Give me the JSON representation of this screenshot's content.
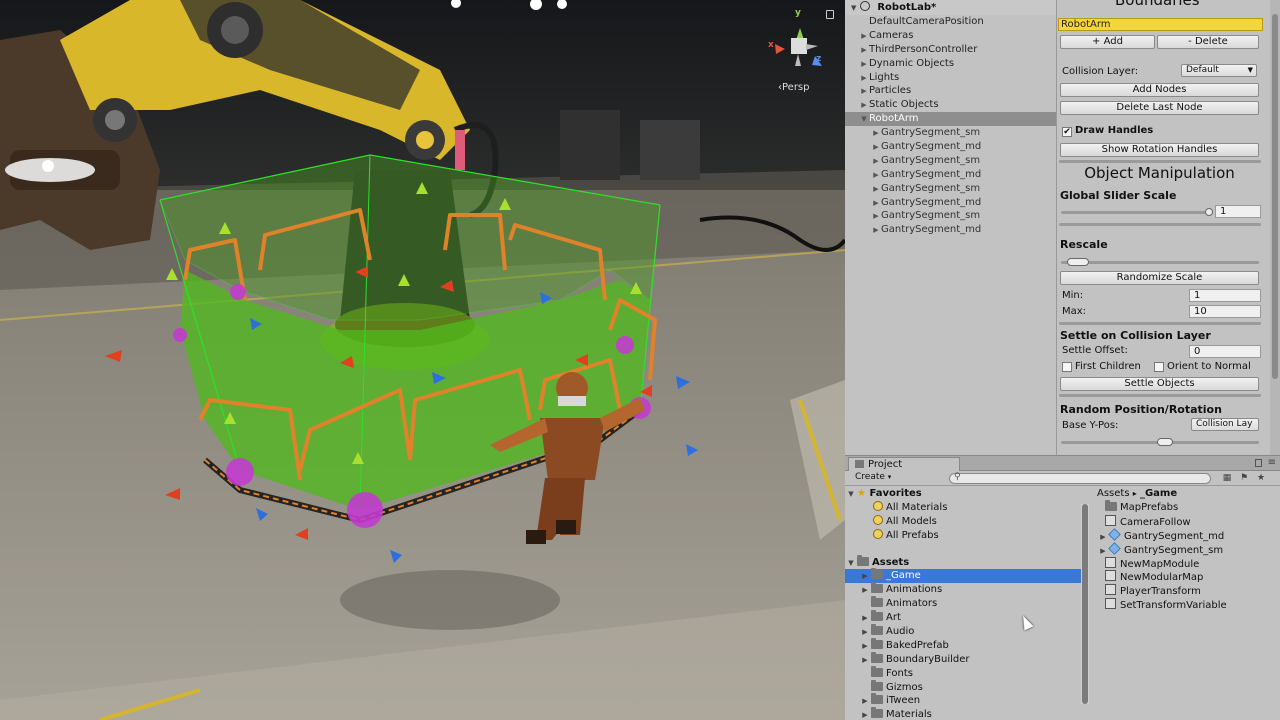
{
  "scene": {
    "persp_label": "‹Persp",
    "axis_y": "y",
    "axis_x": "x",
    "axis_z": "z"
  },
  "hierarchy": {
    "scene_name": "RobotLab*",
    "items": [
      {
        "label": "DefaultCameraPosition",
        "arrow": ""
      },
      {
        "label": "Cameras",
        "arrow": "▶"
      },
      {
        "label": "ThirdPersonController",
        "arrow": "▶"
      },
      {
        "label": "Dynamic Objects",
        "arrow": "▶"
      },
      {
        "label": "Lights",
        "arrow": "▶"
      },
      {
        "label": "Particles",
        "arrow": "▶"
      },
      {
        "label": "Static Objects",
        "arrow": "▶"
      },
      {
        "label": "RobotArm",
        "arrow": "▼",
        "selected": true
      },
      {
        "label": "GantrySegment_sm",
        "arrow": "▶",
        "child": true
      },
      {
        "label": "GantrySegment_md",
        "arrow": "▶",
        "child": true
      },
      {
        "label": "GantrySegment_sm",
        "arrow": "▶",
        "child": true
      },
      {
        "label": "GantrySegment_md",
        "arrow": "▶",
        "child": true
      },
      {
        "label": "GantrySegment_sm",
        "arrow": "▶",
        "child": true
      },
      {
        "label": "GantrySegment_md",
        "arrow": "▶",
        "child": true
      },
      {
        "label": "GantrySegment_sm",
        "arrow": "▶",
        "child": true
      },
      {
        "label": "GantrySegment_md",
        "arrow": "▶",
        "child": true
      }
    ]
  },
  "inspector": {
    "header": "Boundaries",
    "name_value": "RobotArm",
    "add_label": "+ Add",
    "delete_label": "- Delete",
    "collision_layer_label": "Collision Layer:",
    "collision_layer_value": "Default",
    "add_nodes_label": "Add Nodes",
    "delete_last_node_label": "Delete Last Node",
    "draw_handles_label": "Draw Handles",
    "draw_handles_checked": "✔",
    "show_rotation_handles_label": "Show Rotation Handles",
    "object_manipulation_title": "Object Manipulation",
    "global_slider_scale_label": "Global Slider Scale",
    "global_slider_scale_value": "1",
    "rescale_label": "Rescale",
    "randomize_scale_label": "Randomize Scale",
    "min_label": "Min:",
    "min_value": "1",
    "max_label": "Max:",
    "max_value": "10",
    "settle_title": "Settle on Collision Layer",
    "settle_offset_label": "Settle Offset:",
    "settle_offset_value": "0",
    "first_children_label": "First Children",
    "orient_to_normal_label": "Orient to Normal",
    "settle_objects_label": "Settle Objects",
    "random_pos_title": "Random Position/Rotation",
    "base_ypos_label": "Base Y-Pos:",
    "base_ypos_value": "Collision Lay"
  },
  "project": {
    "tab_label": "Project",
    "create_label": "Create",
    "favorites_label": "Favorites",
    "favorites": [
      "All Materials",
      "All Models",
      "All Prefabs"
    ],
    "assets_label": "Assets",
    "folders": [
      {
        "label": "_Game",
        "arrow": "▶",
        "selected": true
      },
      {
        "label": "Animations",
        "arrow": "▶"
      },
      {
        "label": "Animators",
        "arrow": ""
      },
      {
        "label": "Art",
        "arrow": "▶"
      },
      {
        "label": "Audio",
        "arrow": "▶"
      },
      {
        "label": "BakedPrefab",
        "arrow": "▶"
      },
      {
        "label": "BoundaryBuilder",
        "arrow": "▶"
      },
      {
        "label": "Fonts",
        "arrow": ""
      },
      {
        "label": "Gizmos",
        "arrow": ""
      },
      {
        "label": "iTween",
        "arrow": "▶"
      },
      {
        "label": "Materials",
        "arrow": "▶"
      }
    ],
    "breadcrumb_root": "Assets",
    "breadcrumb_sep": "▸",
    "breadcrumb_current": "_Game",
    "files": [
      {
        "label": "MapPrefabs",
        "kind": "folder"
      },
      {
        "label": "CameraFollow",
        "kind": "asset"
      },
      {
        "label": "GantrySegment_md",
        "kind": "prefab"
      },
      {
        "label": "GantrySegment_sm",
        "kind": "prefab"
      },
      {
        "label": "NewMapModule",
        "kind": "asset"
      },
      {
        "label": "NewModularMap",
        "kind": "asset"
      },
      {
        "label": "PlayerTransform",
        "kind": "asset"
      },
      {
        "label": "SetTransformVariable",
        "kind": "asset"
      }
    ]
  }
}
